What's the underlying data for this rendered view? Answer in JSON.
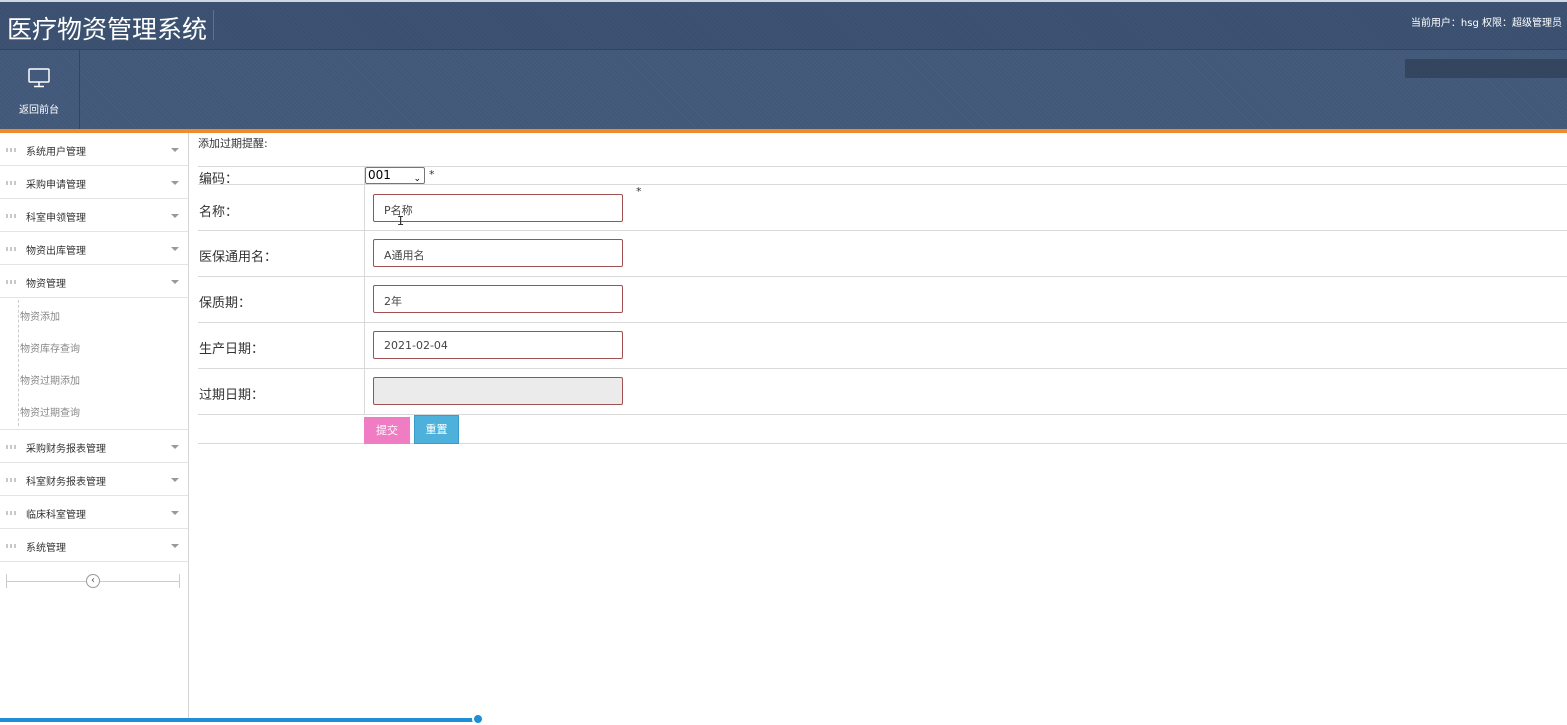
{
  "header": {
    "title": "医疗物资管理系统",
    "user_info": "当前用户：hsg  权限：超级管理员"
  },
  "toolbar": {
    "back_label": "返回前台",
    "back_icon": "monitor-icon"
  },
  "sidebar": {
    "items": [
      {
        "label": "系统用户管理"
      },
      {
        "label": "采购申请管理"
      },
      {
        "label": "科室申领管理"
      },
      {
        "label": "物资出库管理"
      },
      {
        "label": "物资管理"
      },
      {
        "label": "采购财务报表管理"
      },
      {
        "label": "科室财务报表管理"
      },
      {
        "label": "临床科室管理"
      },
      {
        "label": "系统管理"
      }
    ],
    "sub_items": [
      "物资添加",
      "物资库存查询",
      "物资过期添加",
      "物资过期查询"
    ],
    "collapse_icon": "chevron-left-icon"
  },
  "main": {
    "page_title": "添加过期提醒:",
    "fields": {
      "code": {
        "label": "编码：",
        "value": "001",
        "required_mark": "*"
      },
      "name": {
        "label": "名称：",
        "value": "P名称",
        "required_mark": "*"
      },
      "insurance_name": {
        "label": "医保通用名：",
        "value": "A通用名"
      },
      "shelf_life": {
        "label": "保质期：",
        "value": "2年"
      },
      "production_date": {
        "label": "生产日期：",
        "value": "2021-02-04"
      },
      "expiry_date": {
        "label": "过期日期：",
        "value": ""
      }
    },
    "buttons": {
      "submit": "提交",
      "reset": "重置"
    }
  },
  "colors": {
    "header_bg": "#3d5271",
    "accent_orange": "#f08a2a",
    "submit_pink": "#f07cc3",
    "reset_blue": "#4db1dc",
    "progress_blue": "#1e8fd6"
  },
  "progress": {
    "fraction": 0.305
  }
}
